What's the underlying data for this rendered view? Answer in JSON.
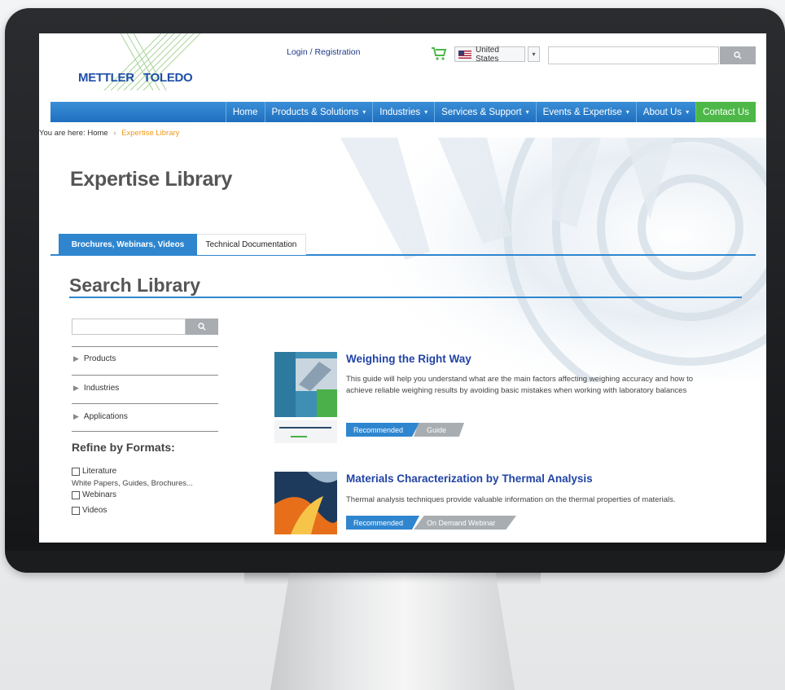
{
  "header": {
    "logo_left": "METTLER",
    "logo_right": "TOLEDO",
    "login": "Login / Registration",
    "country": "United States",
    "country_arrow": "▾",
    "search_placeholder": ""
  },
  "nav": {
    "items": [
      {
        "label": "Home",
        "dropdown": false
      },
      {
        "label": "Products & Solutions",
        "dropdown": true
      },
      {
        "label": "Industries",
        "dropdown": true
      },
      {
        "label": "Services & Support",
        "dropdown": true
      },
      {
        "label": "Events & Expertise",
        "dropdown": true
      },
      {
        "label": "About Us",
        "dropdown": true
      }
    ],
    "contact": "Contact Us",
    "chevron": "▾"
  },
  "breadcrumb": {
    "prefix": "You are here:",
    "home": "Home",
    "separator": "›",
    "current": "Expertise Library"
  },
  "page": {
    "title": "Expertise Library",
    "tabs": [
      "Brochures, Webinars, Videos",
      "Technical Documentation"
    ],
    "section_title": "Search Library"
  },
  "sidebar": {
    "search_placeholder": "",
    "facets": [
      "Products",
      "Industries",
      "Applications"
    ],
    "facet_marker": "▶",
    "refine_title": "Refine by Formats:",
    "formats": [
      {
        "label": "Literature",
        "checked": false
      },
      {
        "label": "Webinars",
        "checked": false
      },
      {
        "label": "Videos",
        "checked": false
      }
    ],
    "literature_sub": "White Papers, Guides, Brochures..."
  },
  "results": [
    {
      "title": "Weighing the Right Way",
      "description": "This guide will help you understand what are the main factors affecting weighing accuracy and how to achieve reliable weighing results by avoiding basic mistakes when working with laboratory balances",
      "tags": [
        "Recommended",
        "Guide"
      ]
    },
    {
      "title": "Materials Characterization by Thermal Analysis",
      "description": "Thermal analysis techniques provide valuable information on the thermal properties of materials.",
      "tags": [
        "Recommended",
        "On Demand Webinar"
      ]
    }
  ],
  "colors": {
    "brand_blue": "#1e4fa8",
    "nav_blue": "#2f86cf",
    "contact_green": "#4db848",
    "breadcrumb_orange": "#f29a1a",
    "result_title": "#2244a6"
  }
}
